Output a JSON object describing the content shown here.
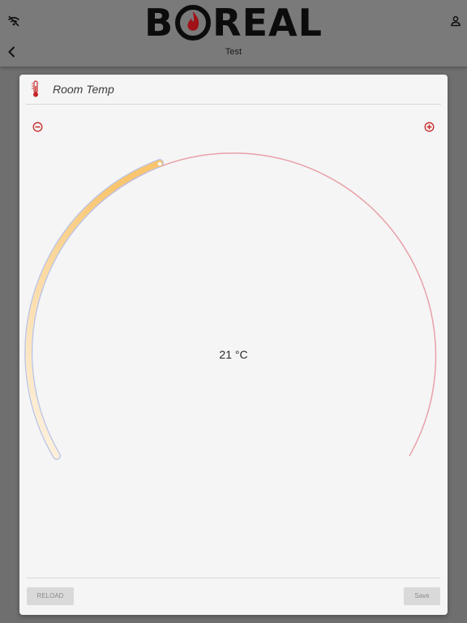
{
  "header": {
    "logo_text": "BOREAL",
    "subtitle": "Test"
  },
  "icons": {
    "status": "wifi-off-icon",
    "account": "user-icon",
    "back": "chevron-left-icon"
  },
  "card": {
    "title": "Room Temp",
    "icon": "thermometer-icon",
    "decrease_icon": "minus-circle-icon",
    "increase_icon": "plus-circle-icon",
    "temperature": "21 °C",
    "dial": {
      "range_color": "#e8a1a8",
      "fill_gradient": [
        "#fdf0dc",
        "#f9c56e"
      ],
      "fill_level": 0.3
    }
  },
  "footer": {
    "reload_label": "RELOAD",
    "save_label": "Save"
  },
  "colors": {
    "accent": "#c62828"
  }
}
